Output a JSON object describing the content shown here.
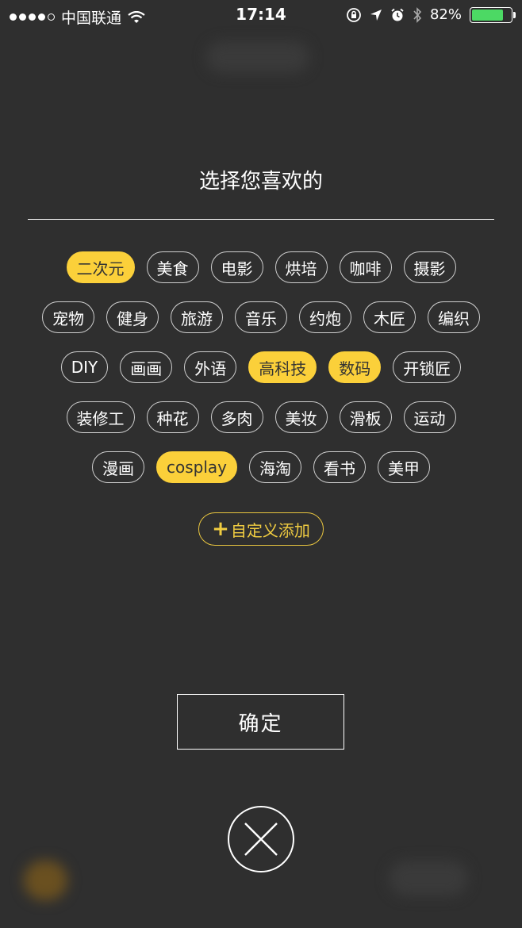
{
  "status_bar": {
    "carrier": "中国联通",
    "time": "17:14",
    "battery": "82%",
    "battery_level": 0.82,
    "icons": [
      "signal-dots-icon",
      "wifi-icon",
      "orientation-lock-icon",
      "location-icon",
      "alarm-icon",
      "bluetooth-icon",
      "battery-icon"
    ]
  },
  "dialog": {
    "title": "选择您喜欢的",
    "tags": [
      {
        "label": "二次元",
        "selected": true
      },
      {
        "label": "美食",
        "selected": false
      },
      {
        "label": "电影",
        "selected": false
      },
      {
        "label": "烘培",
        "selected": false
      },
      {
        "label": "咖啡",
        "selected": false
      },
      {
        "label": "摄影",
        "selected": false
      },
      {
        "label": "宠物",
        "selected": false
      },
      {
        "label": "健身",
        "selected": false
      },
      {
        "label": "旅游",
        "selected": false
      },
      {
        "label": "音乐",
        "selected": false
      },
      {
        "label": "约炮",
        "selected": false
      },
      {
        "label": "木匠",
        "selected": false
      },
      {
        "label": "编织",
        "selected": false
      },
      {
        "label": "DIY",
        "selected": false
      },
      {
        "label": "画画",
        "selected": false
      },
      {
        "label": "外语",
        "selected": false
      },
      {
        "label": "高科技",
        "selected": true
      },
      {
        "label": "数码",
        "selected": true
      },
      {
        "label": "开锁匠",
        "selected": false
      },
      {
        "label": "装修工",
        "selected": false
      },
      {
        "label": "种花",
        "selected": false
      },
      {
        "label": "多肉",
        "selected": false
      },
      {
        "label": "美妆",
        "selected": false
      },
      {
        "label": "滑板",
        "selected": false
      },
      {
        "label": "运动",
        "selected": false
      },
      {
        "label": "漫画",
        "selected": false
      },
      {
        "label": "cosplay",
        "selected": true
      },
      {
        "label": "海淘",
        "selected": false
      },
      {
        "label": "看书",
        "selected": false
      },
      {
        "label": "美甲",
        "selected": false
      }
    ],
    "add_custom_label": "自定义添加",
    "confirm_label": "确定"
  },
  "colors": {
    "background": "#2f2f2f",
    "accent": "#fbd03a",
    "battery_green": "#4cd964"
  }
}
